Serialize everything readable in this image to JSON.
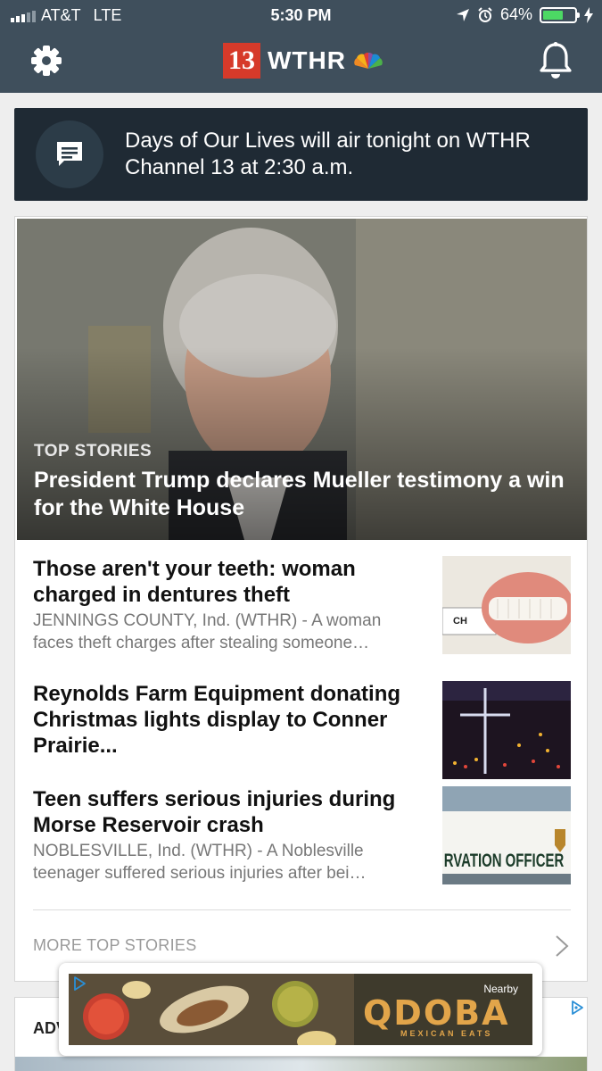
{
  "status_bar": {
    "carrier": "AT&T",
    "network": "LTE",
    "time": "5:30 PM",
    "battery_percent": "64%",
    "battery_level": 0.64
  },
  "app_bar": {
    "logo_number": "13",
    "logo_text": "WTHR"
  },
  "alert": {
    "message": "Days of Our Lives will air tonight on WTHR Channel 13 at 2:30 a.m."
  },
  "top_stories": {
    "kicker": "TOP STORIES",
    "lead_headline": "President Trump declares Mueller testimony a win for the White House",
    "items": [
      {
        "title": "Those aren't your teeth: woman charged in dentures theft",
        "desc_line1": "JENNINGS COUNTY, Ind. (WTHR) - A woman",
        "desc_line2": "faces theft charges after stealing someone…"
      },
      {
        "title": "Reynolds Farm Equipment donating Christmas lights display to Conner Prairie...",
        "desc_line1": "",
        "desc_line2": ""
      },
      {
        "title": "Teen suffers serious injuries during Morse Reservoir crash",
        "desc_line1": "NOBLESVILLE, Ind. (WTHR) - A Noblesville",
        "desc_line2": "teenager suffered serious injuries after bei…"
      }
    ],
    "more_label": "MORE TOP STORIES"
  },
  "second_card": {
    "label": "ADV"
  },
  "ad": {
    "nearby": "Nearby",
    "brand": "QDOBA",
    "tagline": "MEXICAN EATS"
  },
  "thumb_text": {
    "thumb1_label": "CH",
    "thumb3_label": "RVATION  OFFICER"
  },
  "colors": {
    "header_bg": "#3f4f5c",
    "alert_bg": "#1f2a34",
    "logo_red": "#d63a2a",
    "battery_green": "#4cd964"
  }
}
